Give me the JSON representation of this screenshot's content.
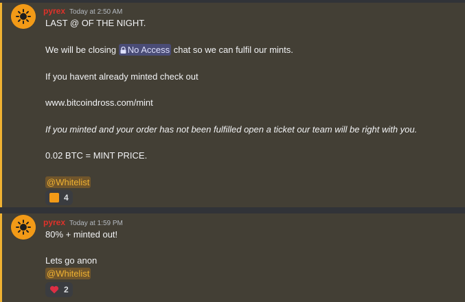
{
  "messages": [
    {
      "username": "pyrex",
      "timestamp": "Today at 2:50 AM",
      "lines": {
        "l1": "LAST @ OF THE NIGHT.",
        "l2_before": "We will be closing ",
        "l2_channel": "No Access",
        "l2_after": " chat so we can fulfil our mints.",
        "l3": "If you havent already minted check out",
        "l4": "www.bitcoindross.com/mint",
        "l5": "If you minted and your order has not been fulfilled open a ticket our team will be right with you.",
        "l6": "0.02 BTC = MINT PRICE."
      },
      "role_mention": "@Whitelist",
      "reaction": {
        "emoji": "orange-square",
        "count": "4"
      }
    },
    {
      "username": "pyrex",
      "timestamp": "Today at 1:59 PM",
      "lines": {
        "l1": "80% + minted out!",
        "l2": "Lets go anon"
      },
      "role_mention": "@Whitelist",
      "reaction": {
        "emoji": "red-heart",
        "count": "2"
      }
    }
  ],
  "colors": {
    "username": "#e0322a",
    "highlight_bar": "#f0b232",
    "highlight_bg": "#433f35",
    "mention_text": "#f0b232"
  }
}
